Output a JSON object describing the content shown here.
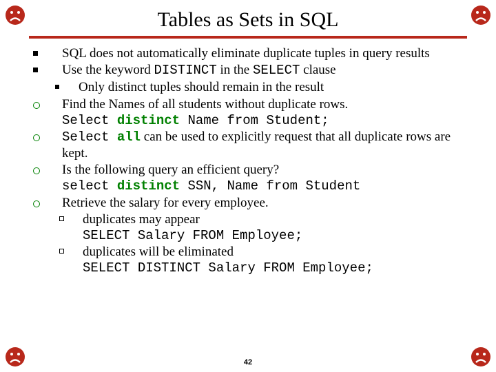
{
  "title": "Tables as Sets in SQL",
  "page_number": "42",
  "b1": "SQL does not automatically eliminate duplicate tuples in query results",
  "b2_pre": "Use the keyword ",
  "b2_kw1": "DISTINCT",
  "b2_mid": " in the ",
  "b2_kw2": "SELECT",
  "b2_post": " clause",
  "b2_sub": "Only distinct tuples should remain in the result",
  "b3": "Find the Names of all students without duplicate rows.",
  "b3_code_pre": "Select ",
  "b3_code_kw": "distinct",
  "b3_code_post": " Name from Student;",
  "b4_code_pre": "Select ",
  "b4_code_kw": "all",
  "b4_text": " can be used to explicitly request that all duplicate rows are kept.",
  "b5": "Is the following query an efficient query?",
  "b5_code_pre": "select ",
  "b5_code_kw": "distinct",
  "b5_code_post": " SSN, Name from Student",
  "b6": "Retrieve the salary for every employee.",
  "b6_sub1": "duplicates may appear",
  "b6_code1": "SELECT Salary  FROM Employee;",
  "b6_sub2": "duplicates will be eliminated",
  "b6_code2": "SELECT DISTINCT Salary FROM Employee;"
}
